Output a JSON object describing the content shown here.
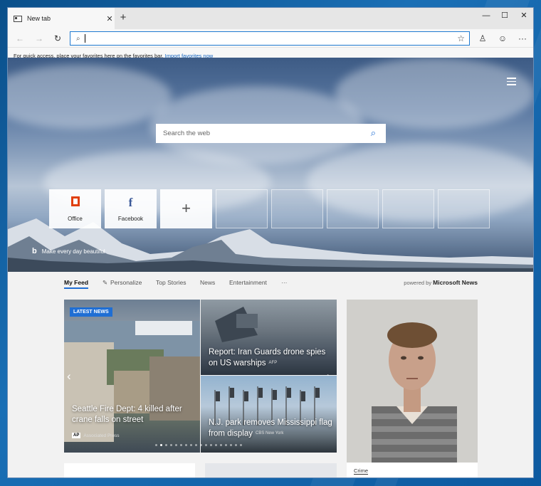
{
  "window": {
    "tab_title": "New tab",
    "tab_close": "✕",
    "new_tab": "+",
    "minimize": "—",
    "maximize": "☐",
    "close": "✕"
  },
  "toolbar": {
    "back": "←",
    "forward": "→",
    "refresh": "↻",
    "search_glyph": "⌕",
    "favorite": "☆",
    "profile": "♙",
    "feedback": "☺",
    "more": "···"
  },
  "favorites_bar": {
    "message": "For quick access, place your favorites here on the favorites bar.",
    "import_link": "Import favorites now"
  },
  "hero": {
    "search_placeholder": "Search the web",
    "search_glyph": "⌕",
    "bing_logo": "b",
    "tagline": "Make every day beautiful",
    "tiles": [
      {
        "label": "Office",
        "icon": "office-icon"
      },
      {
        "label": "Facebook",
        "icon": "f"
      },
      {
        "label": "",
        "icon": "+"
      }
    ]
  },
  "feed_nav": {
    "items": [
      "My Feed",
      "Personalize",
      "Top Stories",
      "News",
      "Entertainment",
      "···"
    ],
    "powered_prefix": "powered by",
    "powered_brand": "Microsoft News",
    "pencil": "✎"
  },
  "carousel": {
    "badge": "LATEST NEWS",
    "prev": "‹",
    "next": "›",
    "stories": [
      {
        "headline": "Seattle Fire Dept: 4 killed after crane falls on street",
        "source": "Associated Press",
        "source_logo": "AP"
      },
      {
        "headline": "Report: Iran Guards drone spies on US warships",
        "source": "AFP"
      },
      {
        "headline": "N.J. park removes Mississippi flag from display",
        "source": "CBS New York"
      }
    ],
    "dot_count": 18,
    "active_dot": 1
  },
  "right_card": {
    "category": "Crime"
  },
  "colors": {
    "accent": "#1f6ed4",
    "office_orange": "#e0400f",
    "facebook_blue": "#3b5998"
  }
}
